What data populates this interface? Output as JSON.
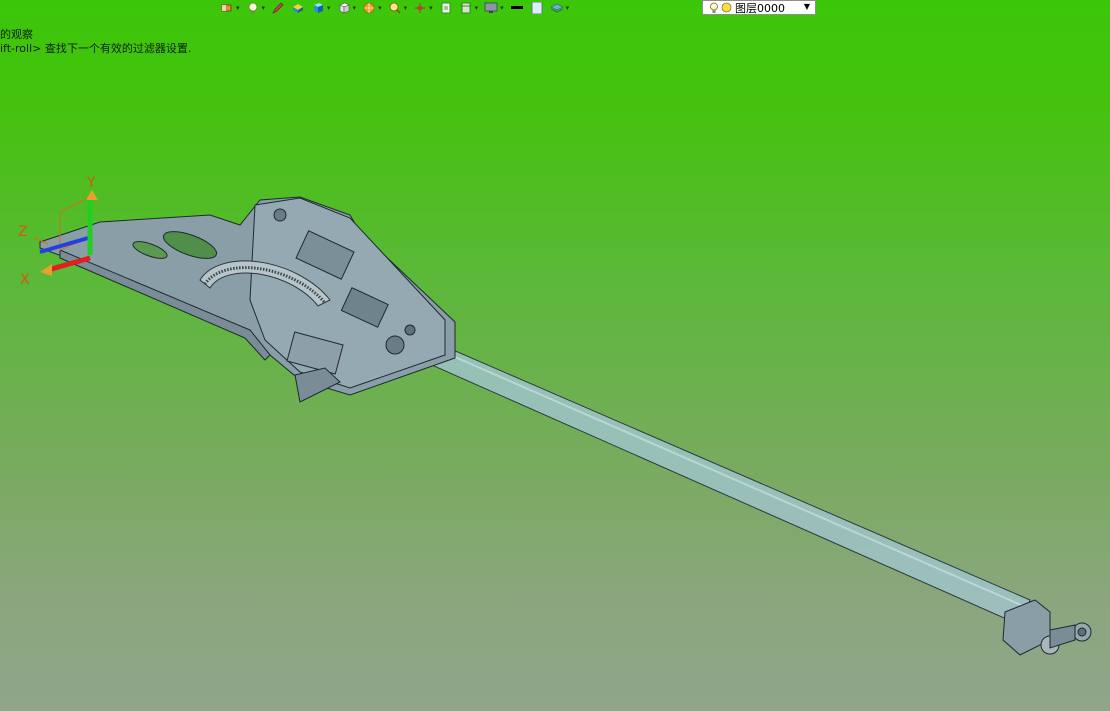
{
  "toolbar": {
    "items": [
      {
        "icon": "eraser-icon"
      },
      {
        "icon": "light-icon"
      },
      {
        "icon": "pen-icon"
      },
      {
        "icon": "paint-bucket-icon"
      },
      {
        "icon": "cube-shaded-icon"
      },
      {
        "icon": "cube-wire-icon"
      },
      {
        "icon": "render-icon"
      },
      {
        "icon": "zoom-icon"
      },
      {
        "icon": "axis-icon"
      },
      {
        "icon": "layer-page-icon"
      },
      {
        "icon": "layer-stack-icon"
      },
      {
        "icon": "monitor-icon"
      },
      {
        "icon": "line-color-icon"
      },
      {
        "icon": "fill-color-icon"
      },
      {
        "icon": "layers-icon"
      }
    ],
    "layer_select": {
      "value": "图层0000"
    }
  },
  "command_line": {
    "line1": "的观察",
    "line2": "ift-roll> 查找下一个有效的过滤器设置."
  },
  "viewport": {
    "axes": {
      "x": "X",
      "y": "Y",
      "z": "Z"
    },
    "colors": {
      "background_top": "#3cc60a",
      "background_bottom": "#90a58a",
      "part": "#8a9ea8",
      "tube": "#9fc3c8"
    }
  }
}
